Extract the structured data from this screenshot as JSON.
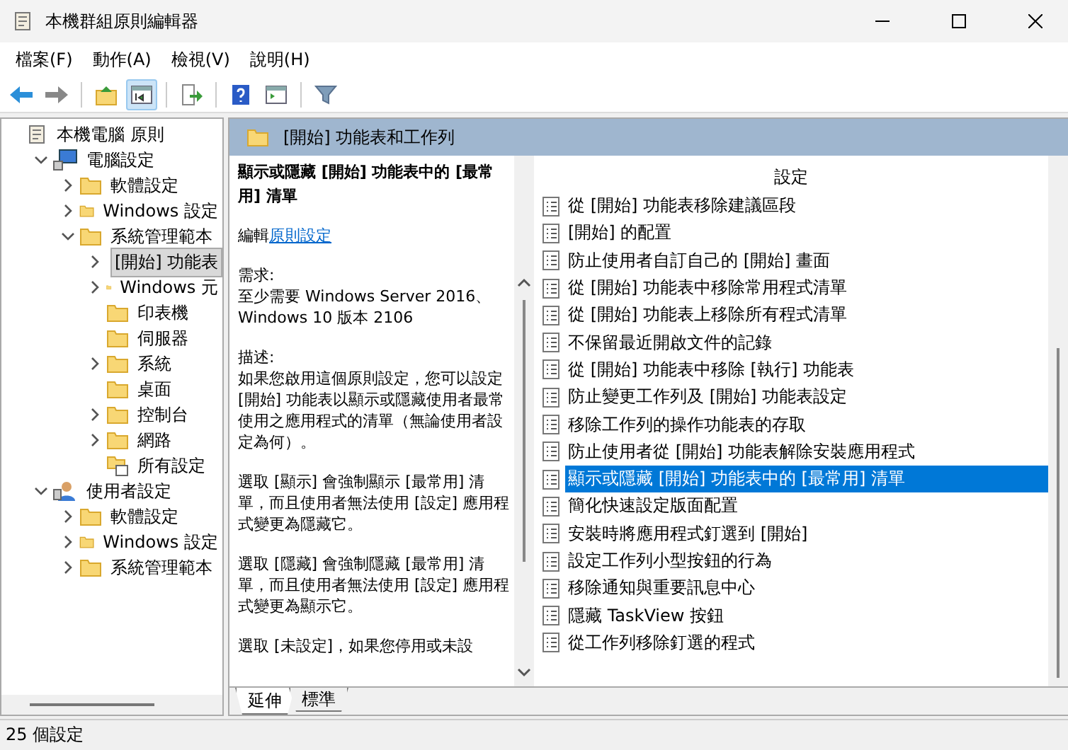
{
  "window": {
    "title": "本機群組原則編輯器"
  },
  "menu": [
    "檔案(F)",
    "動作(A)",
    "檢視(V)",
    "說明(H)"
  ],
  "toolbar": [
    [
      {
        "kind": "back",
        "pressed": false
      },
      {
        "kind": "forward",
        "pressed": false
      }
    ],
    [
      {
        "kind": "up",
        "pressed": false
      },
      {
        "kind": "tree",
        "pressed": true
      }
    ],
    [
      {
        "kind": "export",
        "pressed": false
      }
    ],
    [
      {
        "kind": "help",
        "pressed": false
      },
      {
        "kind": "view",
        "pressed": false
      }
    ],
    [
      {
        "kind": "filter",
        "pressed": false
      }
    ]
  ],
  "tree": [
    {
      "label": "本機電腦 原則",
      "kind": "scroll",
      "selected": false,
      "children": [
        {
          "label": "電腦設定",
          "kind": "computer",
          "expanded": true,
          "selected": false,
          "children": [
            {
              "label": "軟體設定",
              "kind": "folder",
              "expanded": false,
              "selected": false
            },
            {
              "label": "Windows 設定",
              "kind": "folder",
              "expanded": false,
              "selected": false
            },
            {
              "label": "系統管理範本",
              "kind": "folder",
              "expanded": true,
              "selected": false,
              "children": [
                {
                  "label": "[開始] 功能表",
                  "kind": "folder",
                  "expanded": false,
                  "selected": true
                },
                {
                  "label": "Windows 元",
                  "kind": "folder",
                  "expanded": false,
                  "selected": false
                },
                {
                  "label": "印表機",
                  "kind": "folder",
                  "selected": false
                },
                {
                  "label": "伺服器",
                  "kind": "folder",
                  "selected": false
                },
                {
                  "label": "系統",
                  "kind": "folder",
                  "expanded": false,
                  "selected": false
                },
                {
                  "label": "桌面",
                  "kind": "folder",
                  "selected": false
                },
                {
                  "label": "控制台",
                  "kind": "folder",
                  "expanded": false,
                  "selected": false
                },
                {
                  "label": "網路",
                  "kind": "folder",
                  "expanded": false,
                  "selected": false
                },
                {
                  "label": "所有設定",
                  "kind": "settings",
                  "selected": false
                }
              ]
            }
          ]
        },
        {
          "label": "使用者設定",
          "kind": "user",
          "expanded": true,
          "selected": false,
          "children": [
            {
              "label": "軟體設定",
              "kind": "folder",
              "expanded": false,
              "selected": false
            },
            {
              "label": "Windows 設定",
              "kind": "folder",
              "expanded": false,
              "selected": false
            },
            {
              "label": "系統管理範本",
              "kind": "folder",
              "expanded": false,
              "selected": false
            }
          ]
        }
      ]
    }
  ],
  "pane_header": "[開始] 功能表和工作列",
  "description": {
    "title": "顯示或隱藏 [開始] 功能表中的 [最常用] 清單",
    "edit_prefix": "編輯",
    "edit_link": "原則設定",
    "paragraphs": [
      "需求:\n至少需要 Windows Server 2016、Windows 10 版本 2106",
      "描述:\n如果您啟用這個原則設定，您可以設定 [開始] 功能表以顯示或隱藏使用者最常使用之應用程式的清單（無論使用者設定為何）。",
      "選取 [顯示] 會強制顯示 [最常用] 清單，而且使用者無法使用 [設定] 應用程式變更為隱藏它。",
      "選取 [隱藏] 會強制隱藏 [最常用] 清單，而且使用者無法使用 [設定] 應用程式變更為顯示它。",
      "選取 [未設定]，如果您停用或未設"
    ]
  },
  "settings": {
    "column": "設定",
    "rows": [
      {
        "label": "從 [開始] 功能表移除建議區段",
        "selected": false
      },
      {
        "label": "[開始] 的配置",
        "selected": false
      },
      {
        "label": "防止使用者自訂自己的 [開始] 畫面",
        "selected": false
      },
      {
        "label": "從 [開始] 功能表中移除常用程式清單",
        "selected": false
      },
      {
        "label": "從 [開始] 功能表上移除所有程式清單",
        "selected": false
      },
      {
        "label": "不保留最近開啟文件的記錄",
        "selected": false
      },
      {
        "label": "從 [開始] 功能表中移除 [執行] 功能表",
        "selected": false
      },
      {
        "label": "防止變更工作列及 [開始] 功能表設定",
        "selected": false
      },
      {
        "label": "移除工作列的操作功能表的存取",
        "selected": false
      },
      {
        "label": "防止使用者從 [開始] 功能表解除安裝應用程式",
        "selected": false
      },
      {
        "label": "顯示或隱藏 [開始] 功能表中的 [最常用] 清單",
        "selected": true
      },
      {
        "label": "簡化快速設定版面配置",
        "selected": false
      },
      {
        "label": "安裝時將應用程式釘選到 [開始]",
        "selected": false
      },
      {
        "label": "設定工作列小型按鈕的行為",
        "selected": false
      },
      {
        "label": "移除通知與重要訊息中心",
        "selected": false
      },
      {
        "label": "隱藏 TaskView 按鈕",
        "selected": false
      },
      {
        "label": "從工作列移除釘選的程式",
        "selected": false
      }
    ]
  },
  "tabs": [
    {
      "label": "延伸",
      "selected": true
    },
    {
      "label": "標準",
      "selected": false
    }
  ],
  "status_bar": "25 個設定"
}
